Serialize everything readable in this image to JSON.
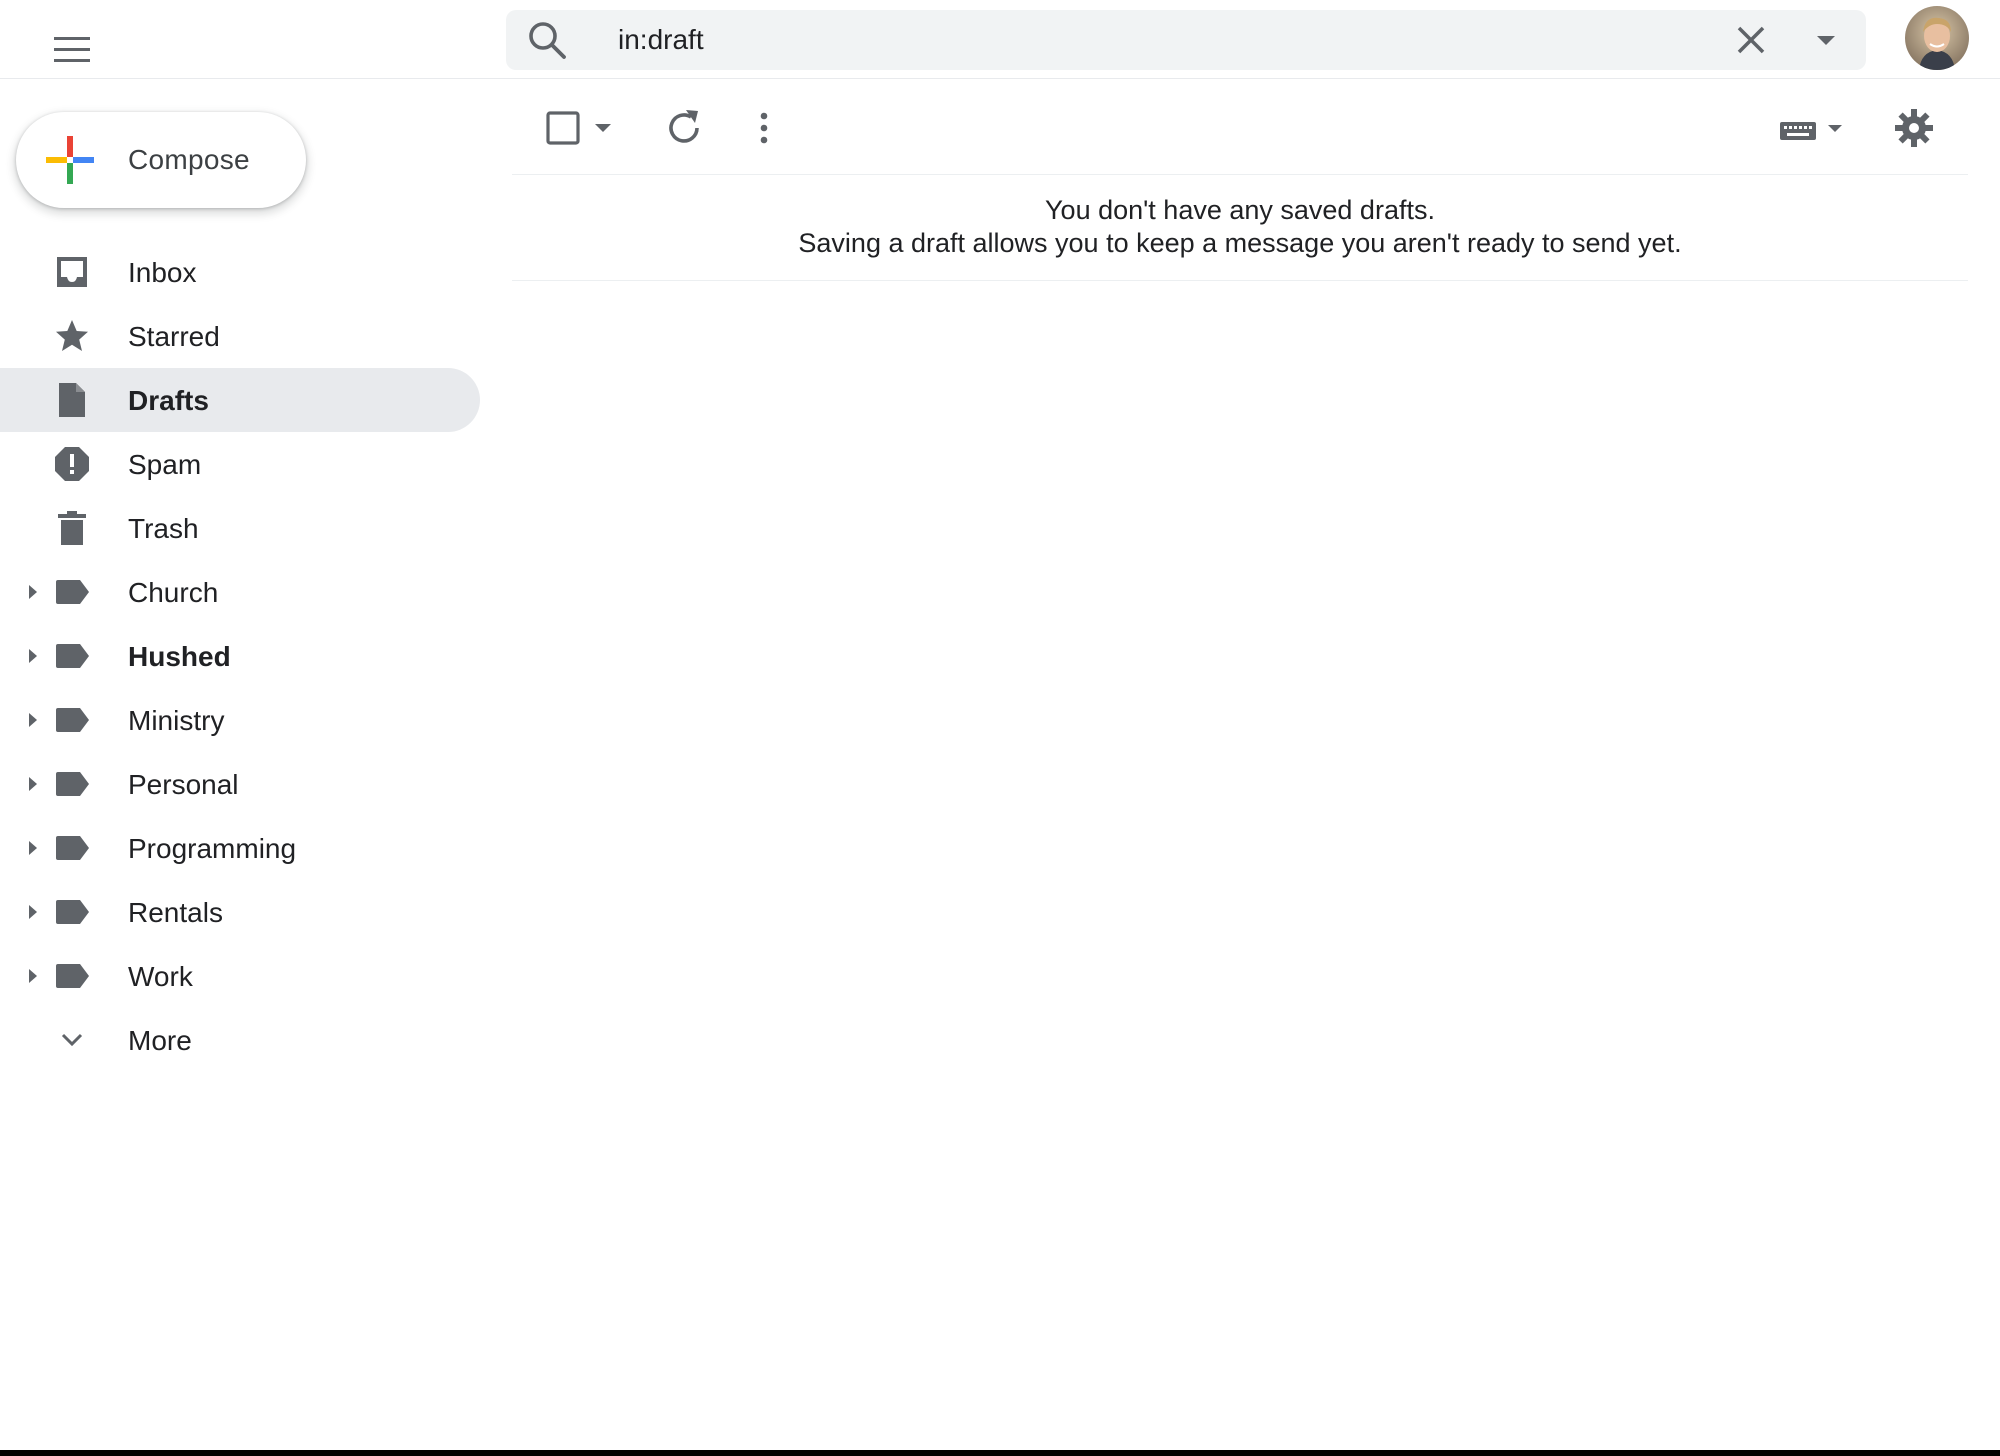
{
  "header": {
    "search": {
      "value": "in:draft"
    }
  },
  "compose": {
    "label": "Compose"
  },
  "sidebar": {
    "items": [
      {
        "label": "Inbox",
        "icon": "inbox-icon"
      },
      {
        "label": "Starred",
        "icon": "star-icon"
      },
      {
        "label": "Drafts",
        "icon": "draft-icon",
        "active": true
      },
      {
        "label": "Spam",
        "icon": "spam-icon"
      },
      {
        "label": "Trash",
        "icon": "trash-icon"
      },
      {
        "label": "Church",
        "icon": "label-icon"
      },
      {
        "label": "Hushed",
        "icon": "label-icon",
        "bold": true
      },
      {
        "label": "Ministry",
        "icon": "label-icon"
      },
      {
        "label": "Personal",
        "icon": "label-icon"
      },
      {
        "label": "Programming",
        "icon": "label-icon"
      },
      {
        "label": "Rentals",
        "icon": "label-icon"
      },
      {
        "label": "Work",
        "icon": "label-icon"
      },
      {
        "label": "More",
        "icon": "chevron-down-icon"
      }
    ]
  },
  "main": {
    "empty_title": "You don't have any saved drafts.",
    "empty_body": "Saving a draft allows you to keep a message you aren't ready to send yet."
  },
  "colors": {
    "active_bg": "#e8eaed",
    "icon_gray": "#5f6368",
    "search_bg": "#f1f3f4"
  }
}
